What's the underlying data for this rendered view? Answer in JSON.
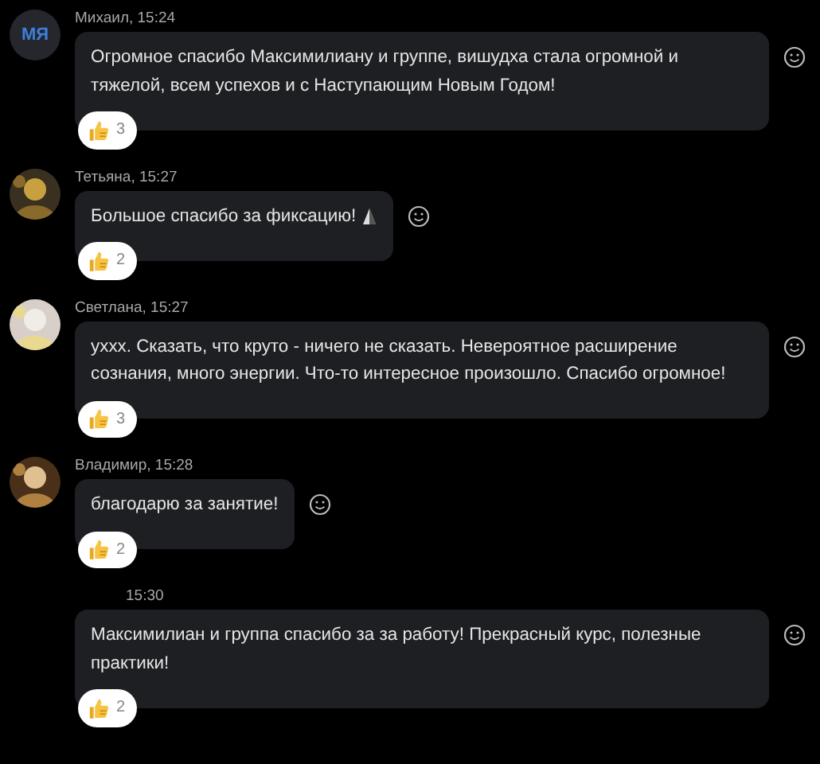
{
  "messages": [
    {
      "meta": "Михаил, 15:24",
      "avatar": {
        "kind": "initials",
        "text": "МЯ"
      },
      "text": "Огромное спасибо Максимилиану и группе, вишудха  стала огромной и тяжелой, всем успехов и с Наступающим Новым Годом!",
      "reaction": {
        "count": "3"
      }
    },
    {
      "meta": "Тетьяна, 15:27",
      "text": "Большое спасибо за фиксацию!",
      "trailing_emoji": true,
      "reaction": {
        "count": "2"
      }
    },
    {
      "meta": "Светлана, 15:27",
      "text": "уххх. Сказать, что круто - ничего не сказать. Невероятное расширение сознания, много энергии. Что-то интересное произошло. Спасибо огромное!",
      "reaction": {
        "count": "3"
      }
    },
    {
      "meta": "Владимир, 15:28",
      "text": "благодарю за занятие!",
      "reaction": {
        "count": "2"
      }
    },
    {
      "meta": "15:30",
      "text": "Максимилиан и группа спасибо за за работу! Прекрасный курс, полезные практики!",
      "reaction": {
        "count": "2"
      }
    }
  ]
}
